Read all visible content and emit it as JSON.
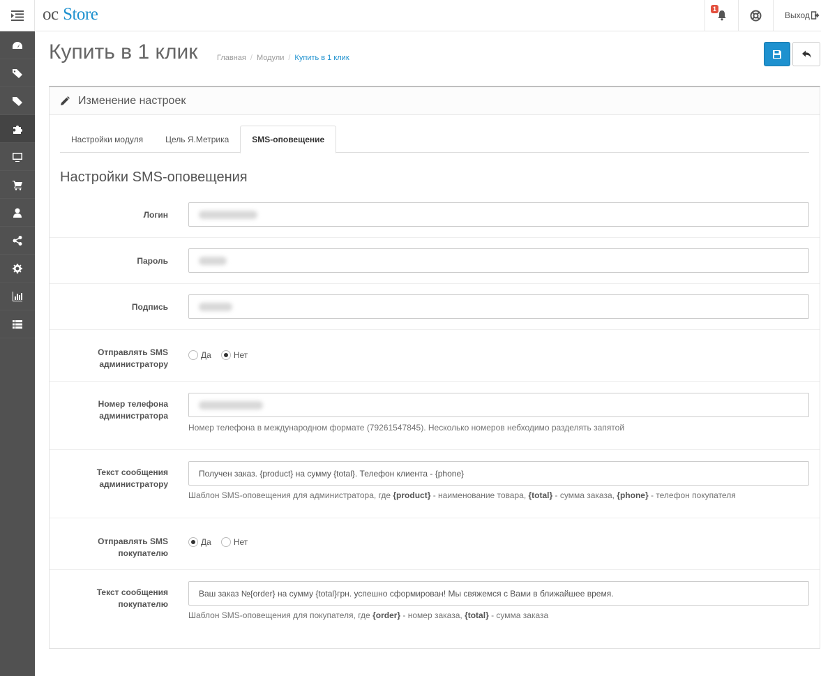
{
  "header": {
    "logo_oc": "oc",
    "logo_store": "Store",
    "notification_count": "1",
    "logout_label": "Выход"
  },
  "sidebar": {
    "items": [
      {
        "icon": "dashboard-icon"
      },
      {
        "icon": "tags-icon"
      },
      {
        "icon": "tags-icon"
      },
      {
        "icon": "puzzle-icon",
        "active": true
      },
      {
        "icon": "monitor-icon"
      },
      {
        "icon": "cart-icon"
      },
      {
        "icon": "user-icon"
      },
      {
        "icon": "share-icon"
      },
      {
        "icon": "gear-icon"
      },
      {
        "icon": "bar-chart-icon"
      },
      {
        "icon": "list-icon"
      }
    ]
  },
  "page": {
    "title": "Купить в 1 клик",
    "breadcrumb": [
      "Главная",
      "Модули",
      "Купить в 1 клик"
    ]
  },
  "panel": {
    "heading": "Изменение настроек",
    "tabs": [
      "Настройки модуля",
      "Цель Я.Метрика",
      "SMS-оповещение"
    ],
    "active_tab": 2,
    "section_title": "Настройки SMS-оповещения"
  },
  "form": {
    "login_label": "Логин",
    "password_label": "Пароль",
    "signature_label": "Подпись",
    "send_admin_label_1": "Отправлять SMS",
    "send_admin_label_2": "администратору",
    "yes": "Да",
    "no": "Нет",
    "send_admin_value": "Нет",
    "phone_label_1": "Номер телефона",
    "phone_label_2": "администратора",
    "phone_help": "Номер телефона в международном формате (79261547845). Несколько номеров небходимо разделять запятой",
    "admin_msg_label_1": "Текст сообщения",
    "admin_msg_label_2": "администратору",
    "admin_msg_value": "Получен заказ. {product} на сумму {total}. Телефон клиента - {phone}",
    "admin_help_1": "Шаблон SMS-оповещения для администратора, где ",
    "admin_help_product": "{product}",
    "admin_help_2": " - наименование товара, ",
    "admin_help_total": "{total}",
    "admin_help_3": " - сумма заказа, ",
    "admin_help_phone": "{phone}",
    "admin_help_4": " - телефон покупателя",
    "send_customer_label_1": "Отправлять SMS",
    "send_customer_label_2": "покупателю",
    "send_customer_value": "Да",
    "customer_msg_label_1": "Текст сообщения",
    "customer_msg_label_2": "покупателю",
    "customer_msg_value": "Ваш заказ №{order} на сумму {total}грн. успешно сформирован! Мы свяжемся с Вами в ближайшее время.",
    "customer_help_1": "Шаблон SMS-оповещения для покупателя, где ",
    "customer_help_order": "{order}",
    "customer_help_2": " - номер заказа, ",
    "customer_help_total": "{total}",
    "customer_help_3": " - сумма заказа"
  }
}
